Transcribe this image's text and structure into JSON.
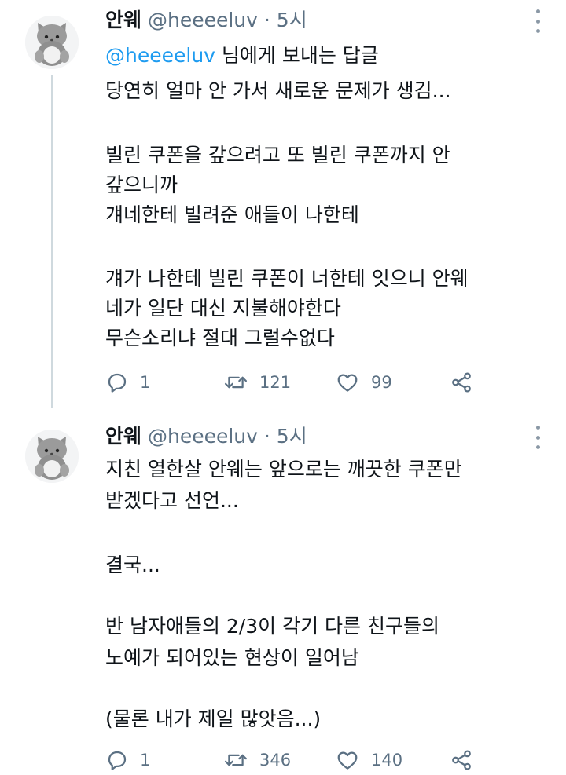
{
  "tweets": [
    {
      "author_name": "안웨",
      "handle": "@heeeeluv",
      "separator": "·",
      "time": "5시",
      "reply_to": {
        "mention": "@heeeeluv",
        "suffix": " 님에게 보내는 답글"
      },
      "body_lines": [
        "당연히 얼마 안 가서 새로운 문제가 생김...",
        "",
        "빌린 쿠폰을 갚으려고 또 빌린 쿠폰까지 안",
        "갚으니까",
        "걔네한테 빌려준 애들이 나한테",
        "",
        "걔가 나한테 빌린 쿠폰이 너한테 잇으니 안웨",
        "네가 일단 대신 지불해야한다",
        "무슨소리냐 절대 그럴수없다"
      ],
      "actions": {
        "reply_count": "1",
        "retweet_count": "121",
        "like_count": "99"
      }
    },
    {
      "author_name": "안웨",
      "handle": "@heeeeluv",
      "separator": "·",
      "time": "5시",
      "body_lines": [
        "지친 열한살 안웨는 앞으로는 깨끗한 쿠폰만",
        "받겠다고 선언...",
        "",
        "결국...",
        "",
        "반 남자애들의 2/3이 각기 다른 친구들의",
        "노예가 되어있는 현상이 일어남",
        "",
        "(물론 내가 제일 많앗음...)"
      ],
      "actions": {
        "reply_count": "1",
        "retweet_count": "346",
        "like_count": "140"
      }
    }
  ],
  "icons": {
    "avatar": "plush-cat-avatar",
    "more": "more-vertical-icon",
    "reply": "reply-icon",
    "retweet": "retweet-icon",
    "like": "heart-icon",
    "share": "share-icon"
  },
  "colors": {
    "text": "#0f1419",
    "secondary": "#5b7083",
    "link": "#1d9bf0",
    "thread_line": "#cfd9de",
    "background": "#ffffff"
  }
}
